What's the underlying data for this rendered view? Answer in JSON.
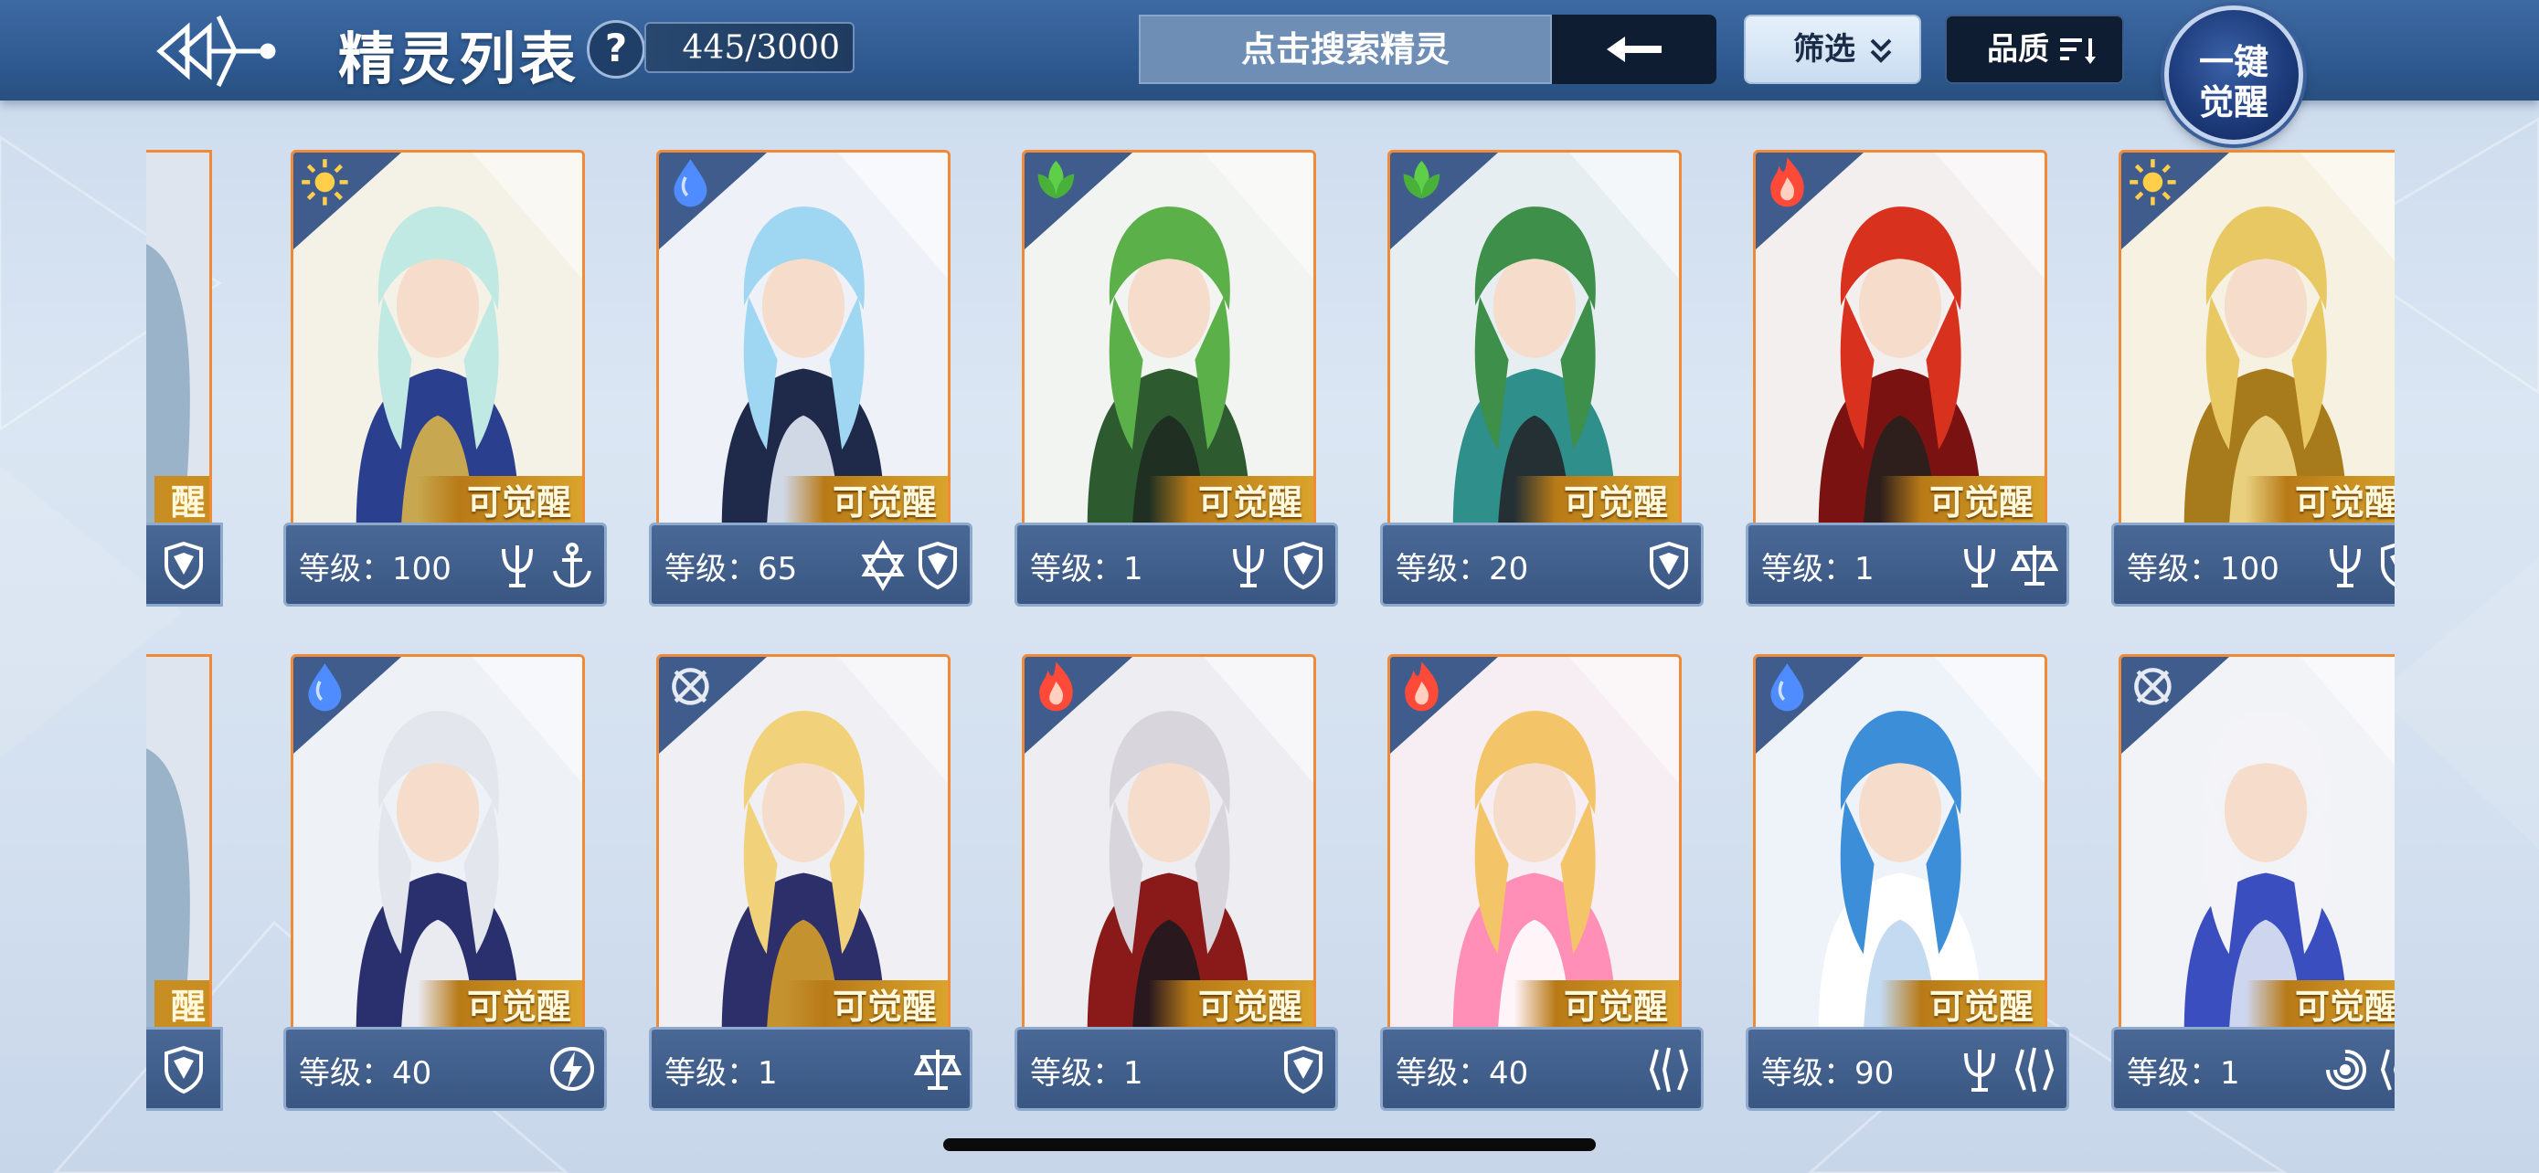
{
  "header": {
    "title": "精灵列表",
    "help_label": "?",
    "count": "445/3000",
    "search_placeholder": "点击搜索精灵",
    "filter_label": "筛选",
    "quality_label": "品质",
    "awaken_line1": "一键",
    "awaken_line2": "觉醒"
  },
  "colors": {
    "header_bg": "#2f5a92",
    "card_border": "#f08a36",
    "info_bar": "#3a5783",
    "awake_tag": "#d9a32c"
  },
  "rows": [
    {
      "cards": [
        {
          "element": "light-icon",
          "awake_label": "可觉醒",
          "level": "等级：100",
          "traits": [
            "trident-icon",
            "anchor-icon"
          ],
          "art": "white-haired-halo"
        },
        {
          "element": "water-icon",
          "awake_label": "可觉醒",
          "level": "等级：65",
          "traits": [
            "hexagram-icon",
            "shield-icon"
          ],
          "art": "blue-haired-horned"
        },
        {
          "element": "grass-icon",
          "awake_label": "可觉醒",
          "level": "等级：1",
          "traits": [
            "trident-icon",
            "shield-icon"
          ],
          "art": "green-haired-archer"
        },
        {
          "element": "grass-icon",
          "awake_label": "可觉醒",
          "level": "等级：20",
          "traits": [
            "shield-icon"
          ],
          "art": "green-haired-cloak"
        },
        {
          "element": "fire-icon",
          "awake_label": "可觉醒",
          "level": "等级：1",
          "traits": [
            "trident-icon",
            "scales-icon"
          ],
          "art": "red-haired-horned"
        },
        {
          "element": "light-icon",
          "awake_label": "可觉醒",
          "level": "等级：100",
          "traits": [
            "trident-icon",
            "shield-icon"
          ],
          "art": "golden-dragon"
        }
      ]
    },
    {
      "cards": [
        {
          "element": "water-icon",
          "awake_label": "可觉醒",
          "level": "等级：40",
          "traits": [
            "lightning-icon"
          ],
          "art": "silver-haired-girl"
        },
        {
          "element": "machine-icon",
          "awake_label": "可觉醒",
          "level": "等级：1",
          "traits": [
            "scales-icon"
          ],
          "art": "blonde-cloaked"
        },
        {
          "element": "fire-icon",
          "awake_label": "可觉醒",
          "level": "等级：1",
          "traits": [
            "shield-icon"
          ],
          "art": "crowned-vampire"
        },
        {
          "element": "fire-icon",
          "awake_label": "可觉醒",
          "level": "等级：40",
          "traits": [
            "claw-icon"
          ],
          "art": "pink-magical-girl"
        },
        {
          "element": "water-icon",
          "awake_label": "可觉醒",
          "level": "等级：90",
          "traits": [
            "trident-icon",
            "claw-icon"
          ],
          "art": "blue-haired-winged"
        },
        {
          "element": "machine-icon",
          "awake_label": "可觉醒",
          "level": "等级：1",
          "traits": [
            "vortex-icon",
            "claw-icon"
          ],
          "art": "white-haired-bride"
        }
      ]
    }
  ],
  "edge_cards": [
    {
      "awake_label": "醒",
      "traits": [
        "shield-icon"
      ]
    },
    {
      "awake_label": "醒",
      "traits": [
        "shield-icon"
      ]
    }
  ]
}
